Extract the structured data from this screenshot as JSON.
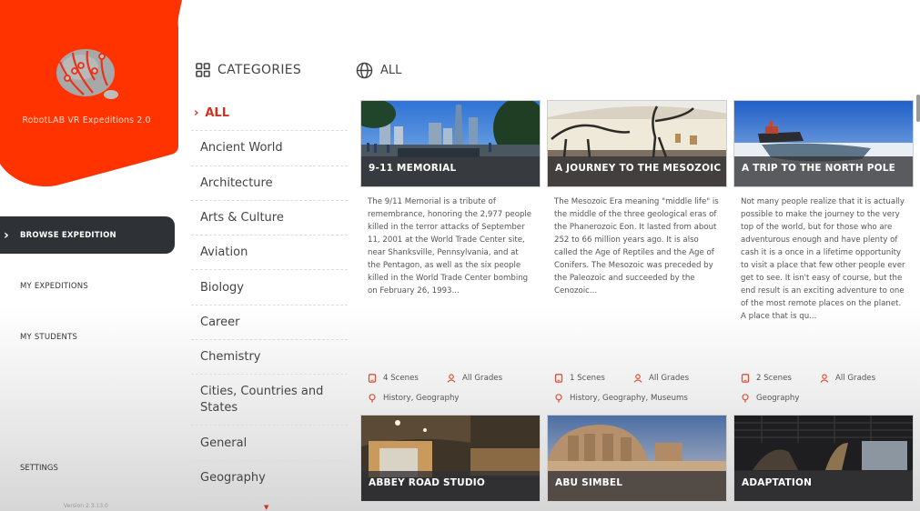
{
  "app": {
    "brand_name": "RobotLAB VR Expeditions 2.0",
    "version": "Version 2.3.13.0",
    "accent_color": "#ff3300"
  },
  "nav": {
    "items": [
      {
        "label": "BROWSE EXPEDITION",
        "icon": "chevron-right-icon",
        "active": true
      },
      {
        "label": "MY EXPEDITIONS",
        "active": false
      },
      {
        "label": "MY STUDENTS",
        "active": false
      }
    ],
    "settings_label": "SETTINGS"
  },
  "categories": {
    "title": "CATEGORIES",
    "icon": "grid-icon",
    "items": [
      {
        "label": "ALL",
        "active": true
      },
      {
        "label": "Ancient World"
      },
      {
        "label": "Architecture"
      },
      {
        "label": "Arts & Culture"
      },
      {
        "label": "Aviation"
      },
      {
        "label": "Biology"
      },
      {
        "label": "Career"
      },
      {
        "label": "Chemistry"
      },
      {
        "label": "Cities, Countries and States"
      },
      {
        "label": "General"
      },
      {
        "label": "Geography"
      }
    ],
    "more_icon": "caret-down-icon"
  },
  "main": {
    "heading": "ALL",
    "heading_icon": "globe-icon",
    "cards": [
      {
        "title": "9-11 MEMORIAL",
        "description": "The 9/11 Memorial is a tribute of remembrance, honoring the 2,977 people killed in the terror attacks of September 11, 2001 at the World Trade Center site, near Shanksville, Pennsylvania, and at the Pentagon, as well as the six people killed in the World Trade Center bombing on February 26, 1993...",
        "scenes": "4 Scenes",
        "grades": "All Grades",
        "subjects": "History, Geography"
      },
      {
        "title": "A JOURNEY TO THE MESOZOIC",
        "description": "The Mesozoic Era meaning \"middle life\" is the middle of the three geological eras of the Phanerozoic Eon. It lasted from about 252 to 66 million years ago. It is also called the Age of Reptiles and the Age of Conifers. The Mesozoic was preceded by the Paleozoic and succeeded by the Cenozoic...",
        "scenes": "1 Scenes",
        "grades": "All Grades",
        "subjects": "History, Geography, Museums"
      },
      {
        "title": "A TRIP TO THE NORTH POLE",
        "description": "Not many people realize that it is actually possible to make the journey to the very top of the world, but for those who are adventurous enough and have plenty of cash  it is a once in a lifetime opportunity to visit a place that few other people ever get to see. It isn't easy of course, but the end result is an exciting adventure to one of the most remote places on the planet. A place that is qu...",
        "scenes": "2 Scenes",
        "grades": "All Grades",
        "subjects": "Geography"
      },
      {
        "title": "ABBEY ROAD STUDIO"
      },
      {
        "title": "ABU SIMBEL"
      },
      {
        "title": "ADAPTATION"
      }
    ]
  }
}
